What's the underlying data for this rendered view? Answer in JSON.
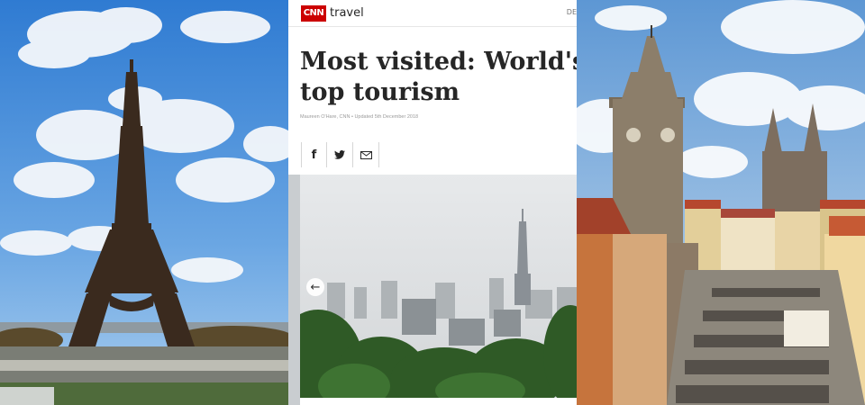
{
  "panels": {
    "left": {
      "icon": "eiffel-tower-photo"
    },
    "middle": {
      "brand": {
        "logo_text": "CNN",
        "section": "travel",
        "edge_text": "DE",
        "logo_color": "#cc0000"
      },
      "headline": "Most visited: World's top tourism",
      "byline": "Maureen O'Hare, CNN • Updated 5th December 2018",
      "share": {
        "facebook_label": "f",
        "icons": [
          "facebook-icon",
          "twitter-icon",
          "email-icon"
        ]
      },
      "carousel": {
        "prev_label": "←"
      }
    },
    "right": {
      "icon": "prague-old-town-photo"
    }
  }
}
